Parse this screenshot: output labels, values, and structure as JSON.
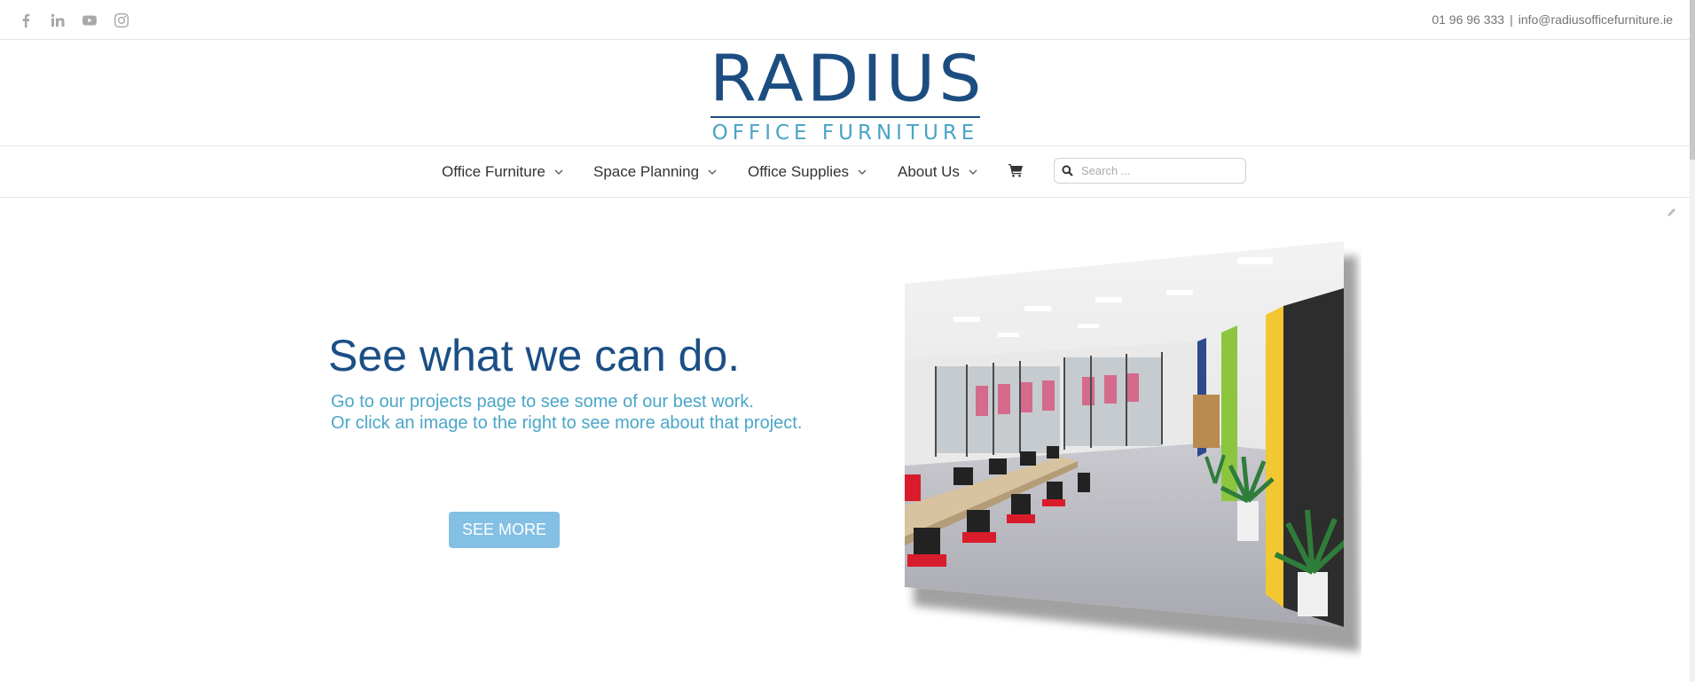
{
  "topbar": {
    "social": [
      {
        "icon": "facebook-icon"
      },
      {
        "icon": "linkedin-icon"
      },
      {
        "icon": "youtube-icon"
      },
      {
        "icon": "instagram-icon"
      }
    ],
    "phone": "01 96 96 333",
    "separator": "|",
    "email": "info@radiusofficefurniture.ie"
  },
  "logo": {
    "main": "RADIUS",
    "sub": "OFFICE FURNITURE",
    "color_main": "#1c4d80",
    "color_sub": "#4aa3c7"
  },
  "nav": {
    "items": [
      {
        "label": "Office Furniture"
      },
      {
        "label": "Space Planning"
      },
      {
        "label": "Office Supplies"
      },
      {
        "label": "About Us"
      }
    ],
    "cart_icon": "shopping-cart-icon",
    "search_placeholder": "Search ..."
  },
  "hero": {
    "headline": "See what we can do.",
    "line1": "Go to our projects page to see some of our best work.",
    "line2": "Or click an image to the right to see more about that project.",
    "button": "SEE MORE",
    "headline_color": "#1b4f85",
    "sub_color": "#4aa6c7",
    "button_color": "#84c0e4"
  }
}
